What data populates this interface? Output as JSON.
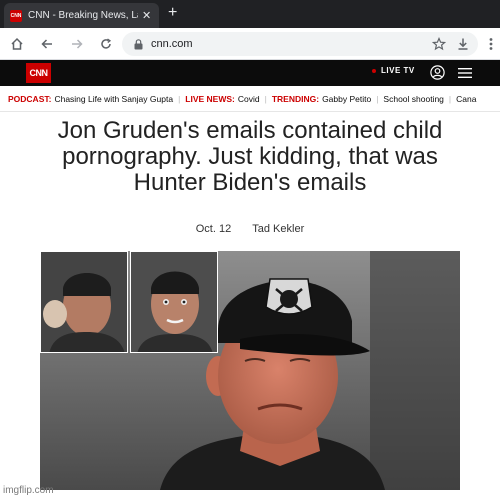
{
  "browser": {
    "tab_title": "CNN - Breaking News, Lat",
    "favicon_text": "CNN",
    "new_tab_icon": "+",
    "close_icon": "✕",
    "url": "cnn.com"
  },
  "cnn": {
    "logo": "CNN",
    "live_tv": "LIVE TV",
    "brand_color": "#cc0000"
  },
  "ticker": [
    {
      "label": "PODCAST:",
      "text": "Chasing Life with Sanjay Gupta"
    },
    {
      "label": "LIVE NEWS:",
      "text": "Covid"
    },
    {
      "label": "TRENDING:",
      "text": "Gabby Petito"
    },
    {
      "label": "",
      "text": "School shooting"
    },
    {
      "label": "",
      "text": "Cana"
    }
  ],
  "article": {
    "headline_line1": "Jon Gruden's emails contained child",
    "headline_line2": "pornography.  Just kidding, that was",
    "headline_line3": "Hunter Biden's emails",
    "date": "Oct. 12",
    "author": "Tad Kekler"
  },
  "watermark": "imgflip.com"
}
